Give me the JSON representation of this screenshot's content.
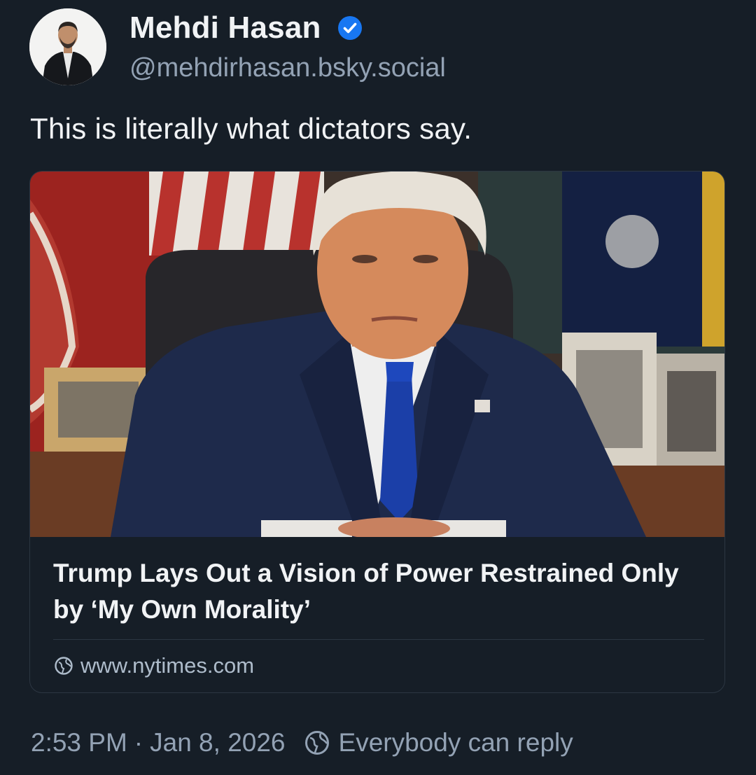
{
  "post": {
    "author": {
      "display_name": "Mehdi Hasan",
      "handle": "@mehdirhasan.bsky.social",
      "verified": true
    },
    "text": "This is literally what dictators say.",
    "link_card": {
      "title": "Trump Lays Out a Vision of Power Restrained Only by ‘My Own Morality’",
      "domain": "www.nytimes.com"
    },
    "time": "2:53 PM",
    "separator": "·",
    "date": "Jan 8, 2026",
    "reply_setting": "Everybody can reply"
  },
  "icons": {
    "verified": "verified-badge-icon",
    "domain": "globe-icon",
    "reply_setting": "globe-icon"
  },
  "colors": {
    "background": "#161e27",
    "text_primary": "#f1f3f5",
    "text_secondary": "#93a2b4",
    "verified_badge": "#1877f2",
    "border": "#2c3642"
  }
}
